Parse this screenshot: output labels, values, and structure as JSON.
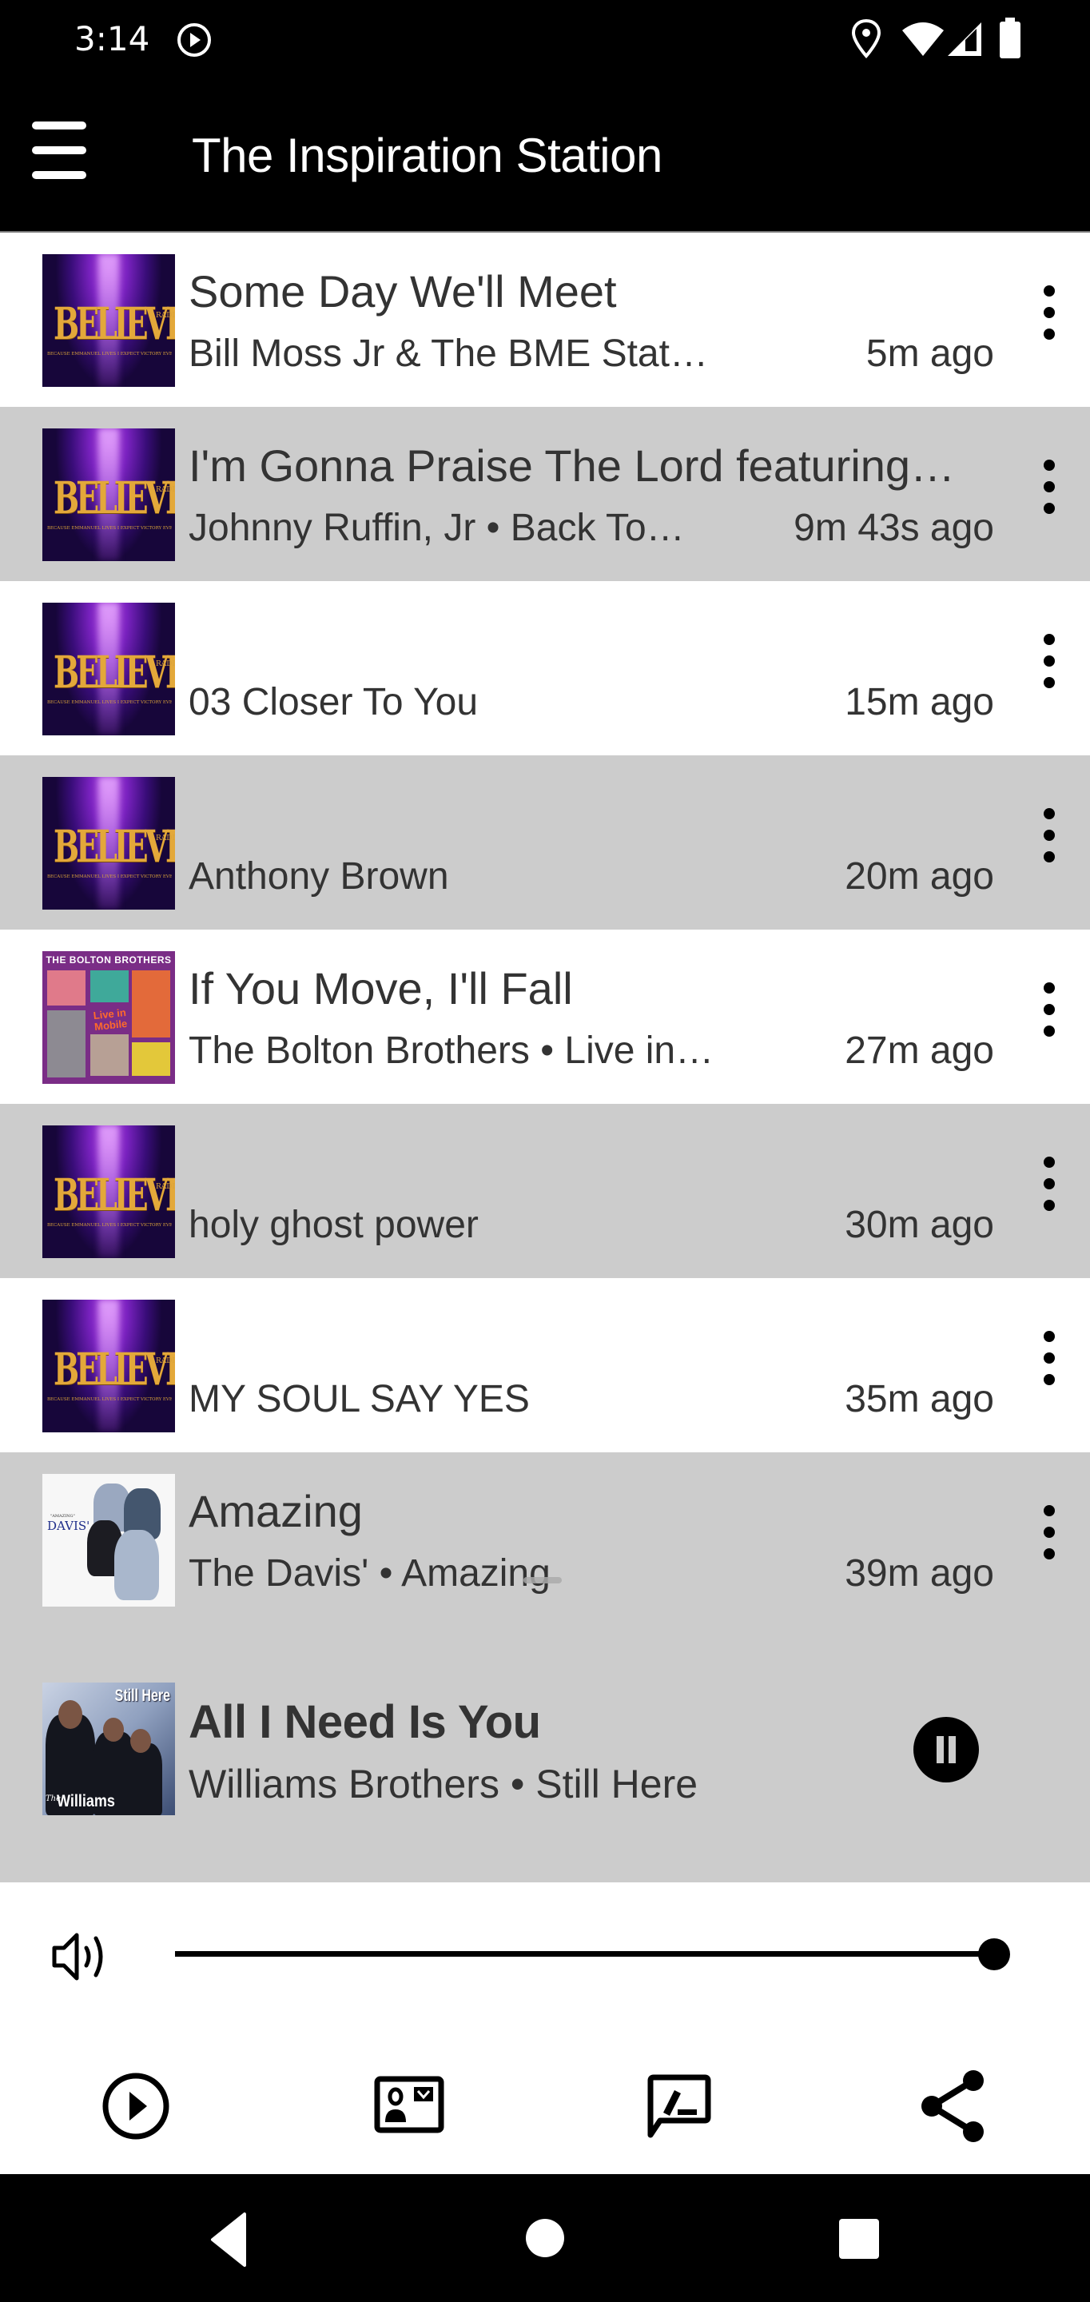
{
  "status_bar": {
    "time": "3:14",
    "icons": [
      "media-playing-icon",
      "location-icon",
      "wifi-icon",
      "cellular-signal-icon",
      "battery-icon"
    ]
  },
  "app_bar": {
    "title": "The Inspiration Station",
    "menu_icon": "hamburger-menu-icon"
  },
  "history": [
    {
      "title": "Some Day We'll Meet",
      "subtitle": "Bill Moss Jr & The BME Stat…",
      "time_ago": "5m ago",
      "art": "believe",
      "shade": "white"
    },
    {
      "title": "I'm Gonna Praise The Lord featuring…",
      "subtitle": "Johnny Ruffin, Jr • Back To…",
      "time_ago": "9m 43s ago",
      "art": "believe",
      "shade": "grey"
    },
    {
      "title": "",
      "subtitle": "03 Closer To You",
      "time_ago": "15m ago",
      "art": "believe",
      "shade": "white"
    },
    {
      "title": "",
      "subtitle": "Anthony Brown",
      "time_ago": "20m ago",
      "art": "believe",
      "shade": "grey"
    },
    {
      "title": "If You Move, I'll Fall",
      "subtitle": "The Bolton Brothers • Live in…",
      "time_ago": "27m ago",
      "art": "bolton",
      "shade": "white"
    },
    {
      "title": "",
      "subtitle": "holy ghost power",
      "time_ago": "30m ago",
      "art": "believe",
      "shade": "grey"
    },
    {
      "title": "",
      "subtitle": "MY SOUL SAY YES",
      "time_ago": "35m ago",
      "art": "believe",
      "shade": "white"
    },
    {
      "title": "Amazing",
      "subtitle": "The Davis' • Amazing",
      "time_ago": "39m ago",
      "art": "davis",
      "shade": "grey"
    }
  ],
  "album_art_text": {
    "believe_word": "BELIEVE",
    "believe_radio": "RADIO",
    "believe_tagline": "BECAUSE EMMANUEL LIVES I EXPECT VICTORY EVERYTIME",
    "bolton_header": "THE BOLTON BROTHERS",
    "bolton_live": "Live in Mobile",
    "davis_amazing": "\"AMAZING\"",
    "davis_name": "DAVIS'",
    "williams_still": "Still Here",
    "williams_the": "The",
    "williams_name": "Williams"
  },
  "now_playing": {
    "title": "All I Need Is You",
    "subtitle": "Williams Brothers • Still Here",
    "state": "playing",
    "button": "pause-icon"
  },
  "volume": {
    "level_percent": 100,
    "icon": "volume-icon"
  },
  "bottom_actions": [
    {
      "name": "play-circle-icon"
    },
    {
      "name": "contact-card-icon"
    },
    {
      "name": "feedback-edit-icon"
    },
    {
      "name": "share-icon"
    }
  ],
  "nav_bar": [
    "back",
    "home",
    "recents"
  ]
}
